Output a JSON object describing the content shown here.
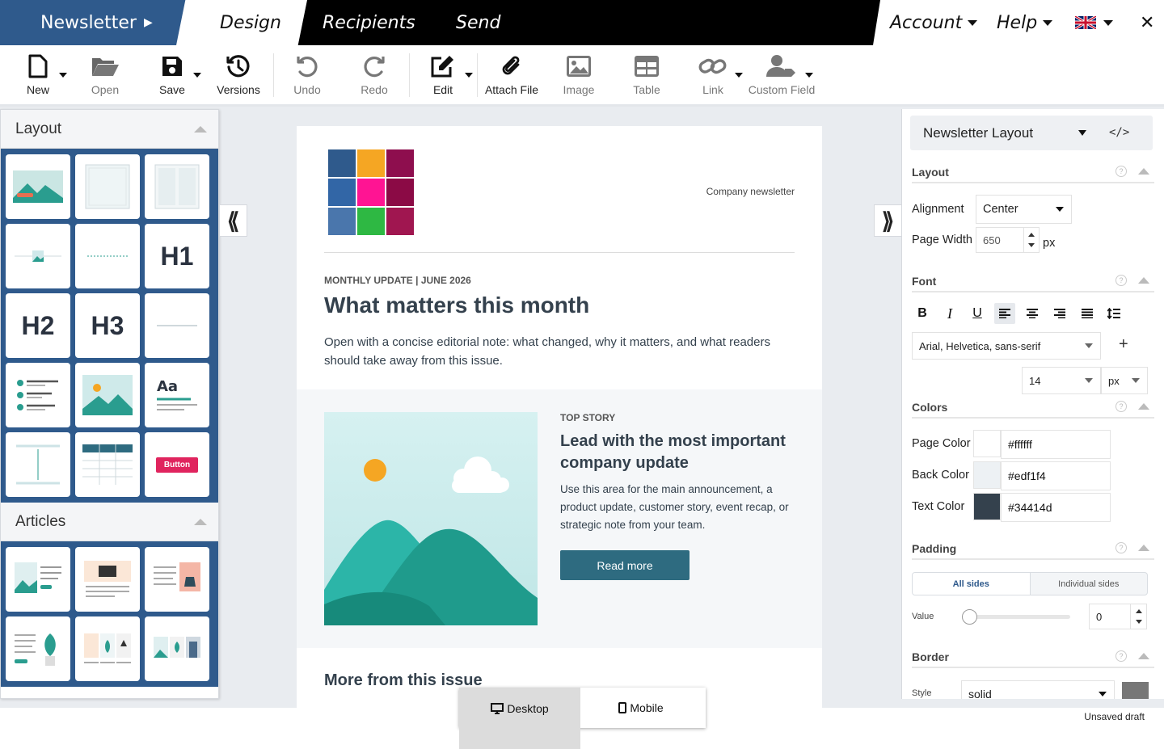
{
  "nav": {
    "brand": "Newsletter",
    "tabs": [
      "Design",
      "Recipients",
      "Send"
    ],
    "account": "Account",
    "help": "Help",
    "language_icon": "uk-flag-icon",
    "close": "✕"
  },
  "toolbar": {
    "new": "New",
    "open": "Open",
    "save": "Save",
    "versions": "Versions",
    "undo": "Undo",
    "redo": "Redo",
    "edit": "Edit",
    "attach": "Attach File",
    "image": "Image",
    "table": "Table",
    "link": "Link",
    "custom_field": "Custom Field"
  },
  "left_panel": {
    "layout_title": "Layout",
    "articles_title": "Articles",
    "layout_tiles": [
      "image-banner",
      "boxed-section",
      "two-columns",
      "image-divider",
      "dotted-divider",
      "H1",
      "H2",
      "H3",
      "line-divider",
      "checklist",
      "image",
      "Aa",
      "spacer",
      "table",
      "Button"
    ],
    "button_tile_label": "Button",
    "aa_label": "Aa"
  },
  "collapse": {
    "left": "⟪",
    "right": "⟫"
  },
  "newsletter": {
    "company": "Company newsletter",
    "logo_colors": [
      "#2f5a8c",
      "#f5a623",
      "#8e0e4e",
      "#3266a6",
      "#ff1493",
      "#8b0a45",
      "#4a76ac",
      "#2eb843",
      "#a01650"
    ],
    "kicker": "MONTHLY UPDATE | JUNE 2026",
    "headline": "What matters this month",
    "intro": "Open with a concise editorial note: what changed, why it matters, and what readers should take away from this issue.",
    "story_kicker": "TOP STORY",
    "story_headline": "Lead with the most important company update",
    "story_body": "Use this area for the main announcement, a product update, customer story, event recap, or strategic note from your team.",
    "read_more": "Read more",
    "more_heading": "More from this issue"
  },
  "device": {
    "desktop": "Desktop",
    "mobile": "Mobile"
  },
  "status": "Unsaved draft",
  "right_panel": {
    "title": "Newsletter Layout",
    "code_icon": "</>",
    "layout_section": "Layout",
    "alignment_label": "Alignment",
    "alignment_value": "Center",
    "page_width_label": "Page Width",
    "page_width_value": "650",
    "page_width_unit": "px",
    "font_section": "Font",
    "font_buttons": [
      "B",
      "I",
      "U"
    ],
    "font_family": "Arial, Helvetica, sans-serif",
    "font_size": "14",
    "font_unit": "px",
    "colors_section": "Colors",
    "page_color_label": "Page Color",
    "page_color": "#ffffff",
    "back_color_label": "Back Color",
    "back_color": "#edf1f4",
    "text_color_label": "Text Color",
    "text_color": "#34414d",
    "padding_section": "Padding",
    "padding_all": "All sides",
    "padding_individual": "Individual sides",
    "value_label": "Value",
    "padding_value": "0",
    "border_section": "Border",
    "border_style": "solid",
    "border_style_label": "Style",
    "help_glyph": "?"
  }
}
